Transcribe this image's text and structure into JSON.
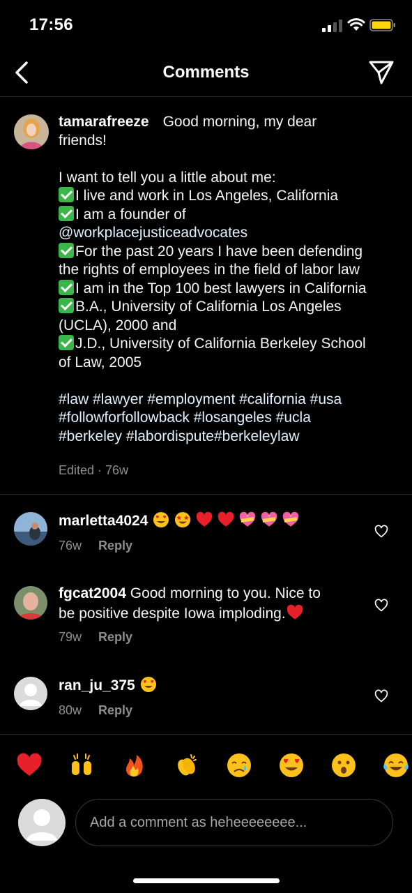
{
  "status_bar": {
    "time": "17:56"
  },
  "header": {
    "title": "Comments"
  },
  "caption": {
    "username": "tamarafreeze",
    "first_line_text": "Good morning, my dear",
    "lines": {
      "l1": "friends!",
      "l2": "I want to tell you a little about me:",
      "l3": "I live and work in Los Angeles, California",
      "l4": "I am a founder of",
      "l5": "@workplacejusticeadvocates",
      "l6": "For the past 20 years I have been defending",
      "l7": "the rights of employees in the field of labor law",
      "l8": "I am in the Top 100 best lawyers in California",
      "l9": "B.A., University of California Los Angeles",
      "l10": "(UCLA), 2000 and",
      "l11": "J.D., University of California Berkeley School",
      "l12": "of Law, 2005",
      "h1": "#law #lawyer #employment #california #usa",
      "h2": "#followforfollowback #losangeles #ucla",
      "h3": "#berkeley #labordispute#berkeleylaw"
    },
    "meta": "Edited · 76w"
  },
  "comments": [
    {
      "username": "marletta4024",
      "text": "",
      "emojis": [
        "heart-eyes",
        "star-struck",
        "red-heart",
        "red-heart",
        "heart-with-ribbon",
        "heart-with-ribbon",
        "heart-with-ribbon"
      ],
      "time": "76w",
      "reply": "Reply"
    },
    {
      "username": "fgcat2004",
      "text_line1": "Good morning to you. Nice to",
      "text_line2": "be positive despite Iowa imploding.",
      "emojis": [
        "red-heart"
      ],
      "time": "79w",
      "reply": "Reply"
    },
    {
      "username": "ran_ju_375",
      "text": "",
      "emojis": [
        "heart-eyes"
      ],
      "time": "80w",
      "reply": "Reply"
    }
  ],
  "reactions": [
    "red-heart",
    "raising-hands",
    "fire",
    "clapping-hands",
    "crying-face",
    "heart-eyes",
    "astonished-face",
    "tears-of-joy"
  ],
  "composer": {
    "placeholder": "Add a comment as heheeeeeeee..."
  },
  "colors": {
    "background": "#000000",
    "text": "#f5f5f5",
    "muted": "#8e8e8e",
    "check": "#3cb54a",
    "heart": "#e8202a"
  }
}
